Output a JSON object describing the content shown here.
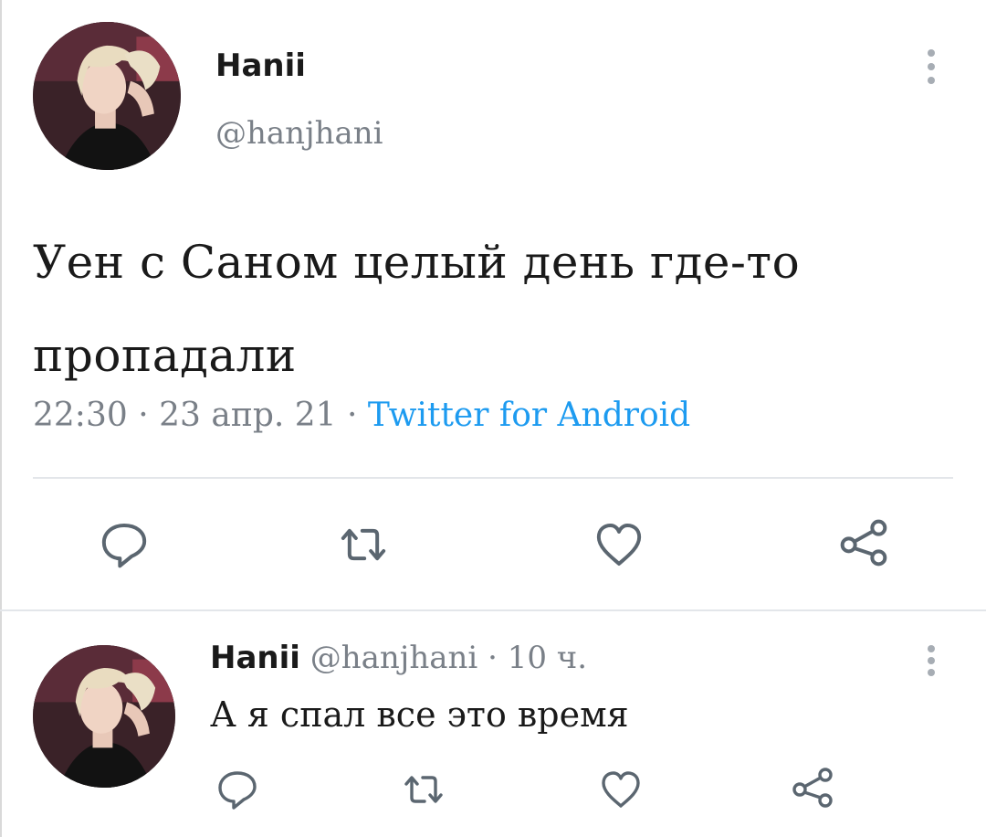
{
  "main_tweet": {
    "author": {
      "name": "Hanii",
      "handle": "@hanjhani",
      "avatar_icon": "profile-photo-icon"
    },
    "text": "Уен с Саном целый день где-то пропадали",
    "time": "22:30",
    "date": "23 апр. 21",
    "separator": "·",
    "source": "Twitter for Android",
    "actions": [
      "reply-icon",
      "retweet-icon",
      "like-icon",
      "share-icon"
    ]
  },
  "reply_tweet": {
    "author": {
      "name": "Hanii",
      "handle": "@hanjhani",
      "avatar_icon": "profile-photo-icon"
    },
    "time_ago": "10 ч.",
    "separator": "·",
    "text": "А я спал все это время",
    "actions": [
      "reply-icon",
      "retweet-icon",
      "like-icon",
      "share-icon"
    ]
  },
  "colors": {
    "link": "#1d9bf0",
    "muted": "#7a8088",
    "text": "#1a1a1a",
    "icon": "#5b6670",
    "divider": "#e3e6ea"
  }
}
